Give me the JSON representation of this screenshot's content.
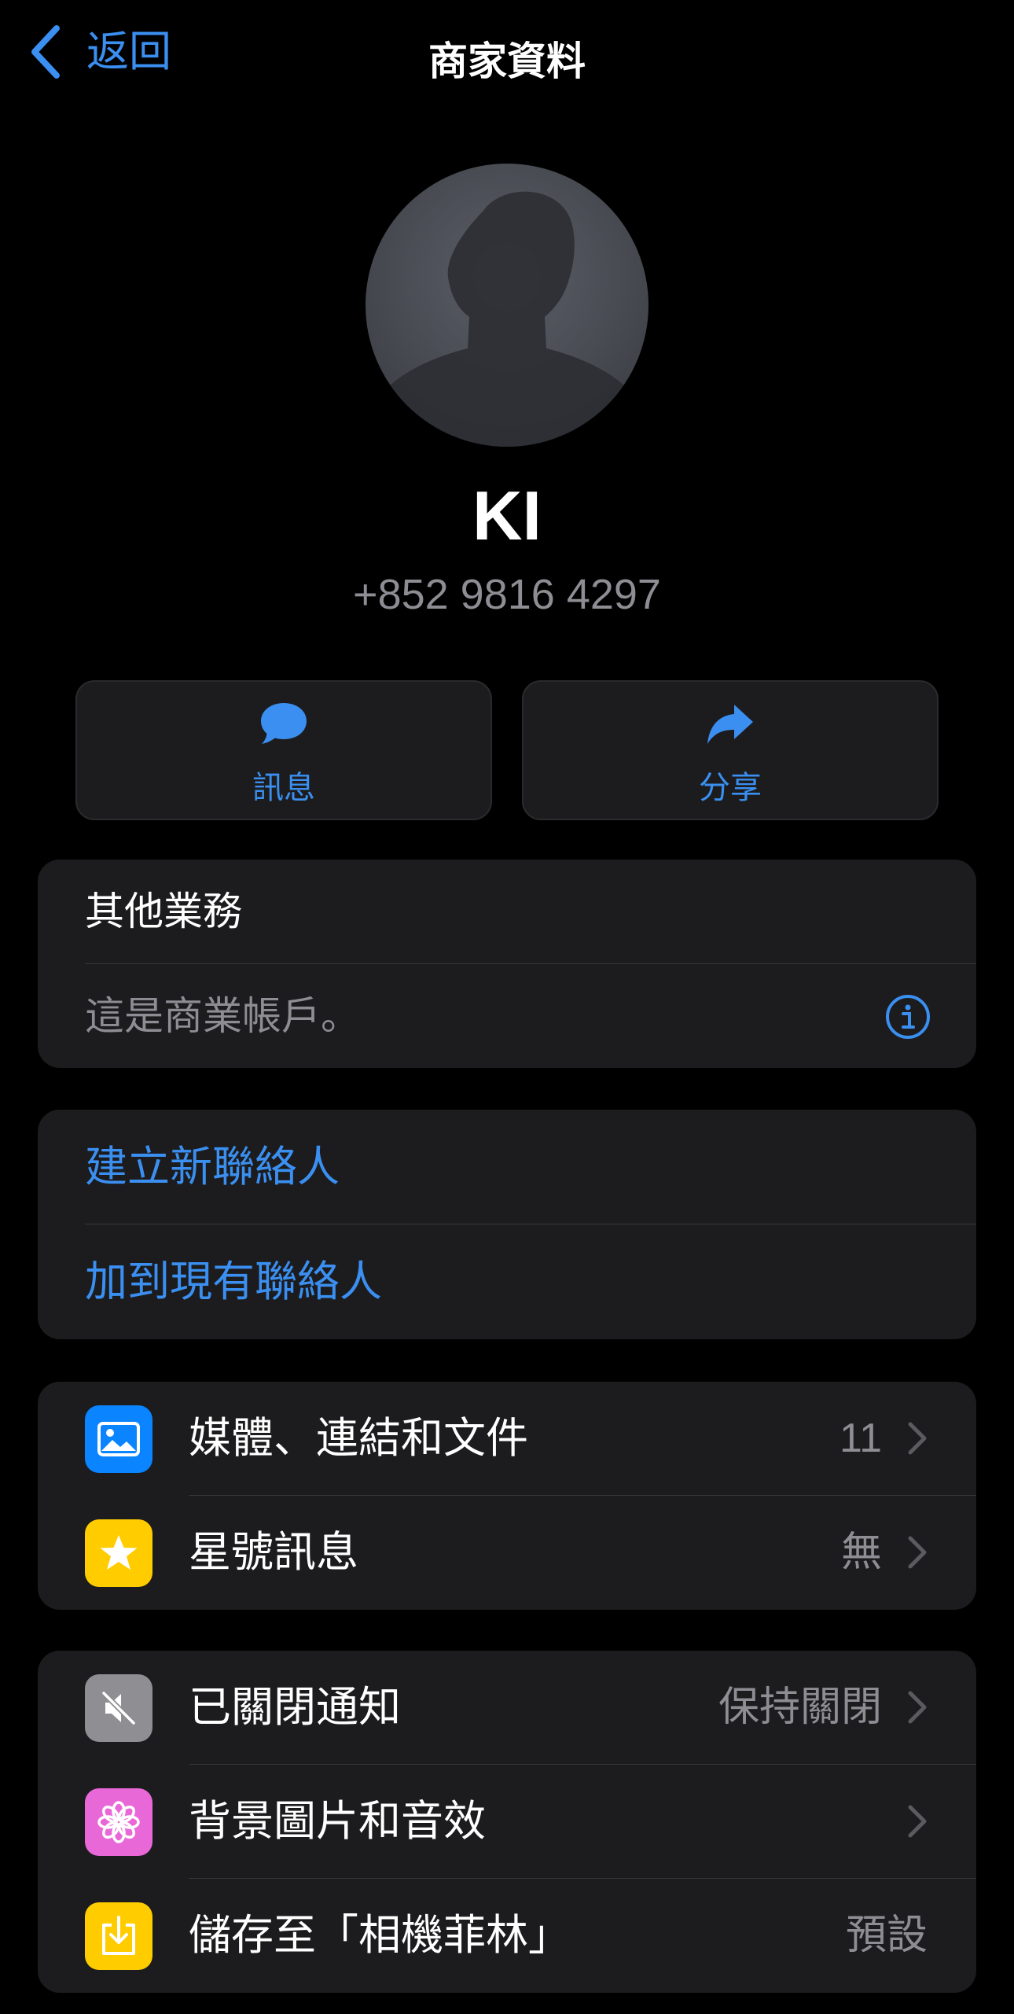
{
  "nav": {
    "back_label": "返回",
    "title": "商家資料"
  },
  "profile": {
    "name": "KI",
    "phone": "+852 9816 4297"
  },
  "actions": [
    {
      "label": "訊息",
      "icon": "message-bubble-icon"
    },
    {
      "label": "分享",
      "icon": "share-arrow-icon"
    }
  ],
  "business": {
    "category": "其他業務",
    "account_note": "這是商業帳戶。"
  },
  "contact_actions": {
    "create_new": "建立新聯絡人",
    "add_existing": "加到現有聯絡人"
  },
  "media_section": [
    {
      "label": "媒體、連結和文件",
      "value": "11",
      "icon": "photo-icon",
      "color": "#0a84ff"
    },
    {
      "label": "星號訊息",
      "value": "無",
      "icon": "star-icon",
      "color": "#ffcc00"
    }
  ],
  "settings_section": [
    {
      "label": "已關閉通知",
      "value": "保持關閉",
      "icon": "speaker-muted-icon",
      "color": "#8e8e93"
    },
    {
      "label": "背景圖片和音效",
      "value": "",
      "icon": "flower-icon",
      "color": "#e968d8"
    },
    {
      "label": "儲存至「相機菲林」",
      "value": "預設",
      "icon": "save-download-icon",
      "color": "#ffcc00"
    }
  ],
  "colors": {
    "accent": "#3a8ff0",
    "card": "#1c1c1e",
    "secondary_text": "#8d8d93"
  }
}
